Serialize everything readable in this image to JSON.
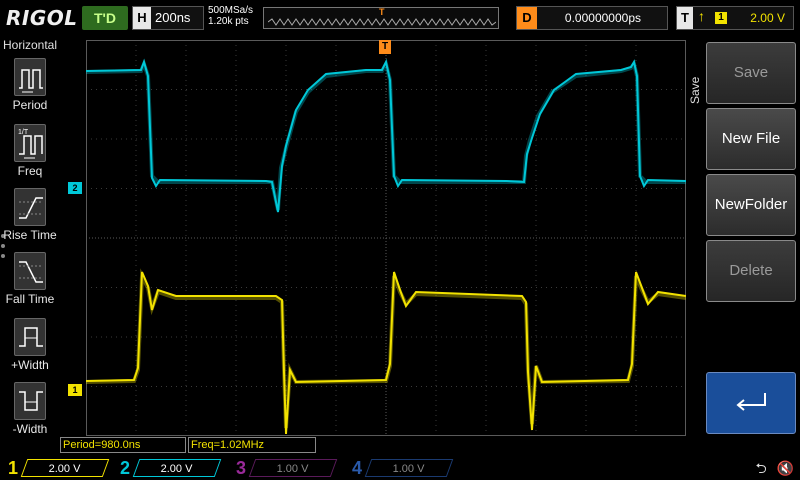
{
  "topbar": {
    "logo": "RIGOL",
    "run_status": "T'D",
    "timebase_label": "H",
    "timebase_value": "200ns",
    "sample_rate": "500MSa/s",
    "memory_points": "1.20k pts",
    "delay_label": "D",
    "delay_value": "0.00000000ps",
    "trigger_label": "T",
    "trigger_source": "1",
    "trigger_level": "2.00 V"
  },
  "left_menu": {
    "title": "Horizontal",
    "items": [
      {
        "label": "Period",
        "icon": "period-icon"
      },
      {
        "label": "Freq",
        "icon": "freq-icon"
      },
      {
        "label": "Rise Time",
        "icon": "rise-time-icon"
      },
      {
        "label": "Fall Time",
        "icon": "fall-time-icon"
      },
      {
        "label": "+Width",
        "icon": "positive-width-icon"
      },
      {
        "label": "-Width",
        "icon": "negative-width-icon"
      }
    ]
  },
  "right_menu": {
    "title": "Save",
    "buttons": [
      {
        "label": "Save",
        "enabled": false
      },
      {
        "label": "New File",
        "enabled": true
      },
      {
        "label": "NewFolder",
        "enabled": true
      },
      {
        "label": "Delete",
        "enabled": false
      },
      {
        "label": "",
        "icon": "return-arrow-icon",
        "enabled": true
      }
    ]
  },
  "markers": {
    "trigger_position": "T",
    "trigger_level": "T",
    "ch1": "1",
    "ch2": "2"
  },
  "measurements": {
    "period": "Period=980.0ns",
    "freq": "Freq=1.02MHz"
  },
  "channels": [
    {
      "num": "1",
      "scale": "2.00 V",
      "active": true,
      "color": "#f2e200"
    },
    {
      "num": "2",
      "scale": "2.00 V",
      "active": true,
      "color": "#00c8d8"
    },
    {
      "num": "3",
      "scale": "1.00 V",
      "active": false,
      "color": "#9a2a9a"
    },
    {
      "num": "4",
      "scale": "1.00 V",
      "active": false,
      "color": "#2a5aaa"
    }
  ],
  "status_icons": [
    "usb-icon",
    "speaker-mute-icon"
  ],
  "colors": {
    "ch1": "#f2e200",
    "ch2": "#00c8d8",
    "trigger": "#ff8c1a",
    "grid": "#4a4a4a"
  }
}
